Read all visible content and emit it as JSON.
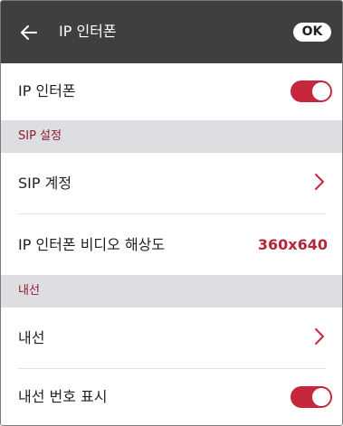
{
  "header": {
    "title": "IP 인터폰",
    "ok_label": "OK"
  },
  "rows": {
    "ip_intercom": {
      "label": "IP 인터폰",
      "toggle_on": true
    },
    "sip_account": {
      "label": "SIP 계정"
    },
    "video_resolution": {
      "label": "IP 인터폰 비디오 해상도",
      "value": "360x640"
    },
    "extension": {
      "label": "내선"
    },
    "show_extension_number": {
      "label": "내선 번호 표시",
      "toggle_on": true
    }
  },
  "sections": {
    "sip": "SIP 설정",
    "extension": "내선"
  },
  "colors": {
    "header_bg": "#3f3f3f",
    "accent": "#c6273d",
    "section_bg": "#dddde2",
    "section_text": "#8a1e2c"
  },
  "icons": {
    "back": "arrow-left-icon",
    "chevron": "chevron-right-icon"
  }
}
